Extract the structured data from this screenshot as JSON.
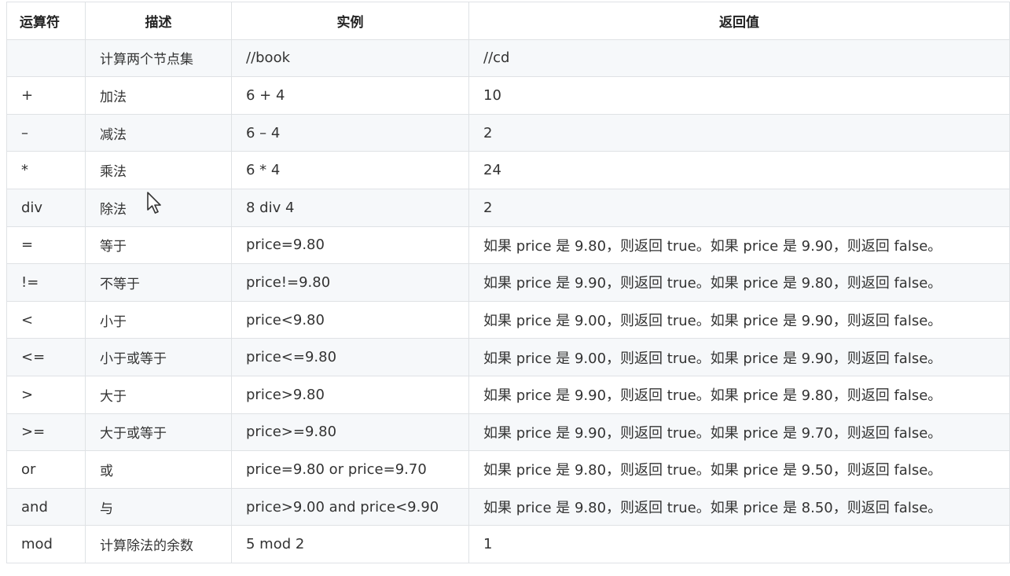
{
  "headers": [
    "运算符",
    "描述",
    "实例",
    "返回值"
  ],
  "rows": [
    [
      "",
      "计算两个节点集",
      "//book",
      "//cd"
    ],
    [
      "+",
      "加法",
      "6 + 4",
      "10"
    ],
    [
      "–",
      "减法",
      "6 – 4",
      "2"
    ],
    [
      "*",
      "乘法",
      "6 * 4",
      "24"
    ],
    [
      "div",
      "除法",
      "8 div 4",
      "2"
    ],
    [
      "=",
      "等于",
      "price=9.80",
      "如果 price 是 9.80，则返回 true。如果 price 是 9.90，则返回 false。"
    ],
    [
      "!=",
      "不等于",
      "price!=9.80",
      "如果 price 是 9.90，则返回 true。如果 price 是 9.80，则返回 false。"
    ],
    [
      "<",
      "小于",
      "price<9.80",
      "如果 price 是 9.00，则返回 true。如果 price 是 9.90，则返回 false。"
    ],
    [
      "<=",
      "小于或等于",
      "price<=9.80",
      "如果 price 是 9.00，则返回 true。如果 price 是 9.90，则返回 false。"
    ],
    [
      ">",
      "大于",
      "price>9.80",
      "如果 price 是 9.90，则返回 true。如果 price 是 9.80，则返回 false。"
    ],
    [
      ">=",
      "大于或等于",
      "price>=9.80",
      "如果 price 是 9.90，则返回 true。如果 price 是 9.70，则返回 false。"
    ],
    [
      "or",
      "或",
      "price=9.80 or price=9.70",
      "如果 price 是 9.80，则返回 true。如果 price 是 9.50，则返回 false。"
    ],
    [
      "and",
      "与",
      "price>9.00 and price<9.90",
      "如果 price 是 9.80，则返回 true。如果 price 是 8.50，则返回 false。"
    ],
    [
      "mod",
      "计算除法的余数",
      "5 mod 2",
      "1"
    ]
  ],
  "colors": {
    "border": "#dfe2e5",
    "stripe": "#f6f8fa",
    "text": "#333333"
  }
}
